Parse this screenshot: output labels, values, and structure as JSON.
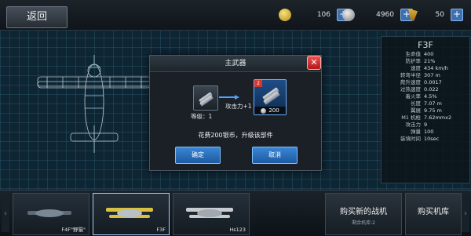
{
  "topbar": {
    "back_label": "返回",
    "resources": [
      {
        "icon": "gold-coin-icon",
        "value": "106"
      },
      {
        "icon": "silver-coin-icon",
        "value": "4960"
      },
      {
        "icon": "harp-icon",
        "value": "50"
      }
    ]
  },
  "plane": {
    "name": "F3F",
    "stats": [
      {
        "label": "生命值",
        "value": "400"
      },
      {
        "label": "防护率",
        "value": "21%"
      },
      {
        "label": "速度",
        "value": "434 km/h"
      },
      {
        "label": "转弯半径",
        "value": "307 m"
      },
      {
        "label": "爬升速度",
        "value": "0.0017"
      },
      {
        "label": "过热速度",
        "value": "0.022"
      },
      {
        "label": "着火率",
        "value": "4.5%"
      },
      {
        "label": "长度",
        "value": "7.07 m"
      },
      {
        "label": "翼展",
        "value": "9.75 m"
      },
      {
        "label": "M1 机枪",
        "value": "7.62mmx2"
      },
      {
        "label": "攻击力",
        "value": "9"
      },
      {
        "label": "弹量",
        "value": "100"
      },
      {
        "label": "装填时间",
        "value": "10sec"
      }
    ]
  },
  "modal": {
    "title": "主武器",
    "current_level": "等级：1",
    "upgrade_effect": "攻击力+1",
    "next_level_badge": "2",
    "cost": "200",
    "message": "花费200银币，升级该部件",
    "ok_label": "确定",
    "cancel_label": "取消"
  },
  "hangar": {
    "cards": [
      {
        "name": "F4F\"野猫\"",
        "selected": false
      },
      {
        "name": "F3F",
        "selected": true
      },
      {
        "name": "Hs123",
        "selected": false
      }
    ],
    "buy_label": "购买新的战机",
    "buy_sub": "剩余机库:2",
    "buy_label2": "购买机库"
  }
}
